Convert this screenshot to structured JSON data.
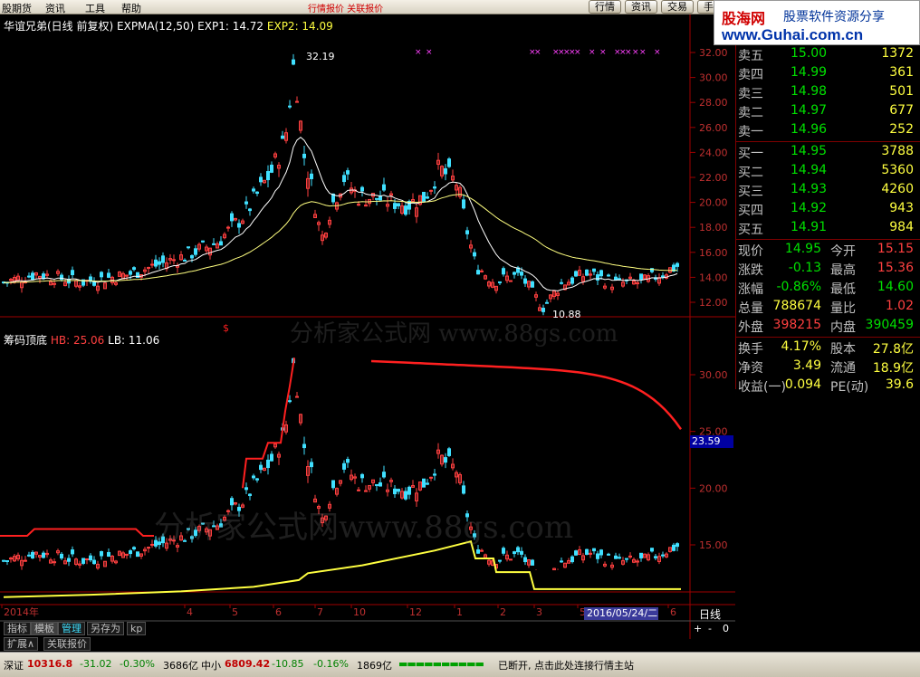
{
  "menu": {
    "items": [
      "股期货",
      "资讯",
      "工具",
      "帮助"
    ],
    "buttons": [
      "行情",
      "资讯",
      "交易",
      "手"
    ],
    "red_hint": "行情报价 关联报价"
  },
  "logo": {
    "brand": "股海网",
    "slogan": "股票软件资源分享",
    "url": "www.Guhai.com.cn"
  },
  "chart": {
    "main_title": "华谊兄弟(日线 前复权)",
    "main_indicator": "EXPMA(12,50)",
    "exp1_label": "EXP1: 14.72",
    "exp2_label": "EXP2: 14.09",
    "peak_label": "32.19",
    "low_label": "10.88",
    "main_axis": [
      "32.00",
      "30.00",
      "28.00",
      "26.00",
      "24.00",
      "22.00",
      "20.00",
      "18.00",
      "16.00",
      "14.00",
      "12.00"
    ],
    "sub_title": "筹码顶底",
    "sub_hb": "HB: 25.06",
    "sub_lb": "LB: 11.06",
    "sub_axis": [
      "30.00",
      "25.00",
      "20.00",
      "15.00"
    ],
    "price_marker": "23.59",
    "time_axis": [
      "2014年",
      "4",
      "5",
      "6",
      "7",
      "10",
      "12",
      "1",
      "2",
      "3",
      "5",
      "6"
    ],
    "current_date": "2016/05/24/二",
    "period": "日线",
    "zoom_buttons": [
      "+",
      "-",
      "0"
    ]
  },
  "quotes": {
    "asks": [
      {
        "label": "卖五",
        "price": "15.00",
        "vol": "1372"
      },
      {
        "label": "卖四",
        "price": "14.99",
        "vol": "361"
      },
      {
        "label": "卖三",
        "price": "14.98",
        "vol": "501"
      },
      {
        "label": "卖二",
        "price": "14.97",
        "vol": "677"
      },
      {
        "label": "卖一",
        "price": "14.96",
        "vol": "252"
      }
    ],
    "bids": [
      {
        "label": "买一",
        "price": "14.95",
        "vol": "3788"
      },
      {
        "label": "买二",
        "price": "14.94",
        "vol": "5360"
      },
      {
        "label": "买三",
        "price": "14.93",
        "vol": "4260"
      },
      {
        "label": "买四",
        "price": "14.92",
        "vol": "943"
      },
      {
        "label": "买五",
        "price": "14.91",
        "vol": "984"
      }
    ],
    "stats": [
      {
        "l1": "现价",
        "v1": "14.95",
        "l2": "今开",
        "v2": "15.15"
      },
      {
        "l1": "涨跌",
        "v1": "-0.13",
        "l2": "最高",
        "v2": "15.36"
      },
      {
        "l1": "涨幅",
        "v1": "-0.86%",
        "l2": "最低",
        "v2": "14.60"
      },
      {
        "l1": "总量",
        "v1": "788674",
        "l2": "量比",
        "v2": "1.02"
      },
      {
        "l1": "外盘",
        "v1": "398215",
        "l2": "内盘",
        "v2": "390459"
      }
    ],
    "fund": [
      {
        "l1": "换手",
        "v1": "4.17%",
        "l2": "股本",
        "v2": "27.8亿"
      },
      {
        "l1": "净资",
        "v1": "3.49",
        "l2": "流通",
        "v2": "18.9亿"
      },
      {
        "l1": "收益(一)",
        "v1": "0.094",
        "l2": "PE(动)",
        "v2": "39.6"
      }
    ]
  },
  "tabs": [
    "指标",
    "模板",
    "管理",
    "另存为",
    "kp"
  ],
  "tabs2": [
    "扩展∧",
    "关联报价"
  ],
  "status": {
    "sz_label": "深证",
    "sz_value": "10316.8",
    "sz_change": "-31.02",
    "sz_pct": "-0.30%",
    "sz_amount": "3686亿",
    "zx_label": "中小",
    "zx_value": "6809.42",
    "zx_change": "-10.85",
    "zx_pct": "-0.16%",
    "zx_amount": "1869亿",
    "msg": "已断开, 点击此处连接行情主站"
  },
  "watermarks": [
    "分析家公式网  www.88gs.com",
    "分析家公式网www.88gs.com"
  ],
  "colors": {
    "up": "#ff4040",
    "down": "#40e0ff",
    "exp1": "#ffffff",
    "exp2": "#ffff80",
    "hb": "#ff2020",
    "lb": "#ffff40"
  }
}
